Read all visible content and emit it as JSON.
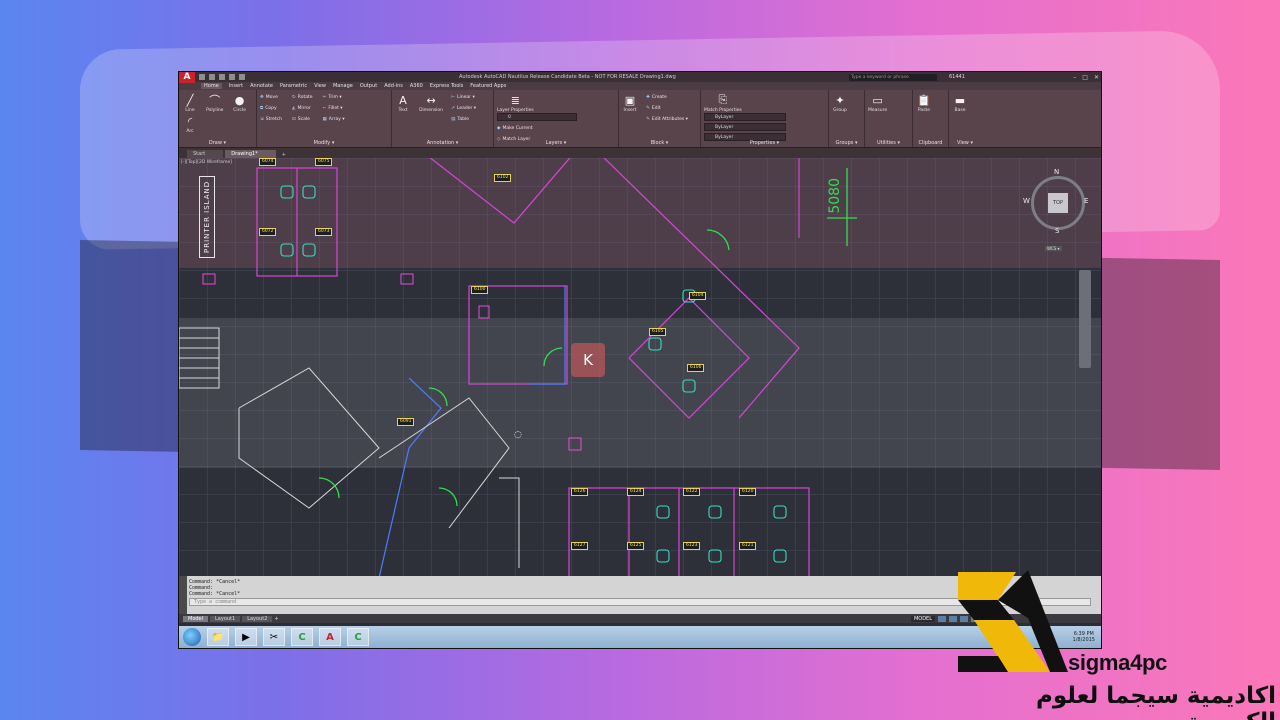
{
  "app": {
    "logo_letter": "A",
    "title": "Autodesk AutoCAD Nautilus Release Candidate Beta - NOT FOR RESALE  Drawing1.dwg",
    "search_placeholder": "Type a keyword or phrase",
    "user": "61441",
    "window_buttons": [
      "–",
      "□",
      "✕"
    ]
  },
  "menu_tabs": [
    "Home",
    "Insert",
    "Annotate",
    "Parametric",
    "View",
    "Manage",
    "Output",
    "Add-ins",
    "A360",
    "Express Tools",
    "Featured Apps"
  ],
  "ribbon": {
    "draw": {
      "title": "Draw ▾",
      "tools": [
        "Line",
        "Polyline",
        "Circle",
        "Arc"
      ]
    },
    "modify": {
      "title": "Modify ▾",
      "rows": [
        [
          "Move",
          "Rotate",
          "Trim ▾"
        ],
        [
          "Copy",
          "Mirror",
          "Fillet ▾"
        ],
        [
          "Stretch",
          "Scale",
          "Array ▾"
        ]
      ]
    },
    "annotation": {
      "title": "Annotation ▾",
      "tools": [
        "Text",
        "Dimension"
      ],
      "rows": [
        "Linear ▾",
        "Leader ▾",
        "Table"
      ]
    },
    "layers": {
      "title": "Layers ▾",
      "tool": "Layer Properties",
      "rows": [
        "0",
        "Make Current",
        "Match Layer"
      ]
    },
    "block": {
      "title": "Block ▾",
      "tool": "Insert",
      "rows": [
        "Create",
        "Edit",
        "Edit Attributes ▾"
      ]
    },
    "properties": {
      "title": "Properties ▾",
      "tool": "Match Properties",
      "combos": [
        "ByLayer",
        "ByLayer",
        "ByLayer"
      ]
    },
    "groups": {
      "title": "Groups ▾",
      "tool": "Group"
    },
    "utilities": {
      "title": "Utilities ▾",
      "tool": "Measure"
    },
    "clipboard": {
      "title": "Clipboard",
      "tool": "Paste"
    },
    "view": {
      "title": "View ▾",
      "tool": "Base"
    }
  },
  "doc_tabs": [
    "Start",
    "Drawing1*",
    "+"
  ],
  "viewport": {
    "label": "[-][Top][2D Wireframe]",
    "printer_island": "PRINTER ISLAND",
    "dimension": "5080",
    "viewcube": {
      "face": "TOP",
      "n": "N",
      "s": "S",
      "e": "E",
      "w": "W",
      "wcs": "WCS ▾"
    },
    "rooms": [
      "6074",
      "6075",
      "6072",
      "6073",
      "6102",
      "6100",
      "6104",
      "6105",
      "6106",
      "6091",
      "6126",
      "6124",
      "6122",
      "6120",
      "6127",
      "6125",
      "6123",
      "6121"
    ],
    "watermark": "K"
  },
  "command_line": {
    "lines": [
      "Command: *Cancel*",
      "Command:",
      "Command: *Cancel*"
    ],
    "input_placeholder": "Type a command"
  },
  "layout_tabs": [
    "Model",
    "Layout1",
    "Layout2",
    "+"
  ],
  "status": {
    "model": "MODEL"
  },
  "taskbar": {
    "apps": [
      "📁",
      "▶",
      "✂",
      "C",
      "A",
      "C"
    ],
    "time": "6:39 PM",
    "date": "1/8/2015"
  },
  "brand": {
    "name": "sigma4pc",
    "arabic": "اكاديمية سيجما لعلوم الكمبيوتر",
    "colors": {
      "gold": "#f0b90a",
      "dark": "#111111"
    }
  }
}
